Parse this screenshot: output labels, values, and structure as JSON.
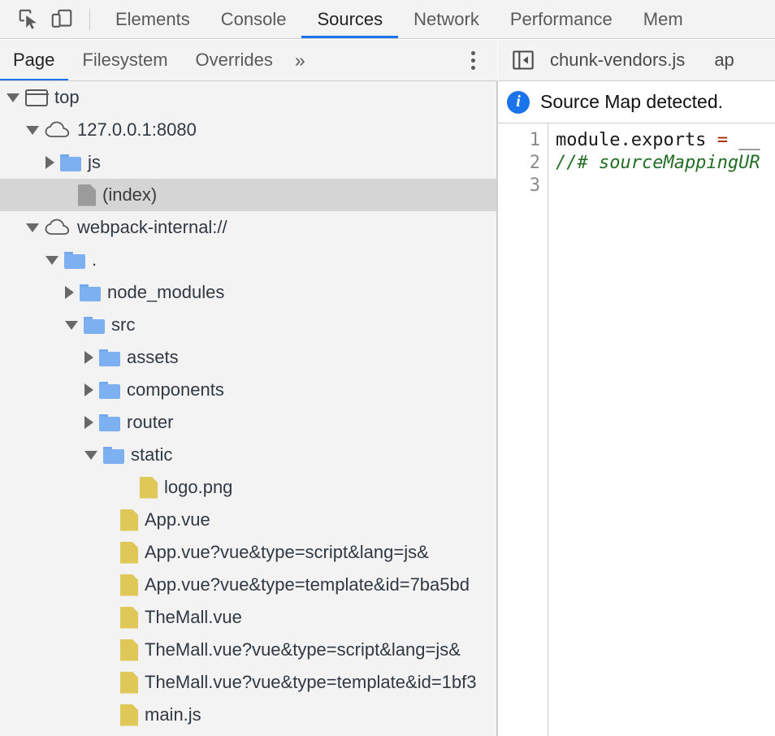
{
  "main_toolbar": {
    "icons": [
      {
        "name": "inspect-element-icon",
        "title": "Inspect element"
      },
      {
        "name": "device-toolbar-icon",
        "title": "Toggle device toolbar"
      }
    ],
    "tabs": [
      {
        "label": "Elements",
        "active": false
      },
      {
        "label": "Console",
        "active": false
      },
      {
        "label": "Sources",
        "active": true
      },
      {
        "label": "Network",
        "active": false
      },
      {
        "label": "Performance",
        "active": false
      },
      {
        "label": "Mem",
        "active": false
      }
    ]
  },
  "navigator": {
    "tabs": [
      {
        "label": "Page",
        "active": true
      },
      {
        "label": "Filesystem",
        "active": false
      },
      {
        "label": "Overrides",
        "active": false
      }
    ],
    "more_tabs_label": "»",
    "menu_icon": "more-options-icon",
    "tree": [
      {
        "label": "top",
        "icon": "frame-icon",
        "twisty": "open",
        "indent": 0,
        "selected": false
      },
      {
        "label": "127.0.0.1:8080",
        "icon": "cloud-icon",
        "twisty": "open",
        "indent": 1,
        "selected": false
      },
      {
        "label": "js",
        "icon": "folder-icon",
        "twisty": "closed",
        "indent": 2,
        "selected": false
      },
      {
        "label": "(index)",
        "icon": "document-icon",
        "twisty": "none",
        "indent": 2,
        "selected": true
      },
      {
        "label": "webpack-internal://",
        "icon": "cloud-icon",
        "twisty": "open",
        "indent": 1,
        "selected": false
      },
      {
        "label": ".",
        "icon": "folder-icon",
        "twisty": "open",
        "indent": 2,
        "selected": false
      },
      {
        "label": "node_modules",
        "icon": "folder-icon",
        "twisty": "closed",
        "indent": 3,
        "selected": false
      },
      {
        "label": "src",
        "icon": "folder-icon",
        "twisty": "open",
        "indent": 3,
        "selected": false
      },
      {
        "label": "assets",
        "icon": "folder-icon",
        "twisty": "closed",
        "indent": 4,
        "selected": false
      },
      {
        "label": "components",
        "icon": "folder-icon",
        "twisty": "closed",
        "indent": 4,
        "selected": false
      },
      {
        "label": "router",
        "icon": "folder-icon",
        "twisty": "closed",
        "indent": 4,
        "selected": false
      },
      {
        "label": "static",
        "icon": "folder-icon",
        "twisty": "open",
        "indent": 4,
        "selected": false
      },
      {
        "label": "logo.png",
        "icon": "file-icon",
        "twisty": "none",
        "indent": 5,
        "selected": false
      },
      {
        "label": "App.vue",
        "icon": "file-icon",
        "twisty": "none",
        "indent": 4,
        "selected": false
      },
      {
        "label": "App.vue?vue&type=script&lang=js&",
        "icon": "file-icon",
        "twisty": "none",
        "indent": 4,
        "selected": false
      },
      {
        "label": "App.vue?vue&type=template&id=7ba5bd",
        "icon": "file-icon",
        "twisty": "none",
        "indent": 4,
        "selected": false
      },
      {
        "label": "TheMall.vue",
        "icon": "file-icon",
        "twisty": "none",
        "indent": 4,
        "selected": false
      },
      {
        "label": "TheMall.vue?vue&type=script&lang=js&",
        "icon": "file-icon",
        "twisty": "none",
        "indent": 4,
        "selected": false
      },
      {
        "label": "TheMall.vue?vue&type=template&id=1bf3",
        "icon": "file-icon",
        "twisty": "none",
        "indent": 4,
        "selected": false
      },
      {
        "label": "main.js",
        "icon": "file-icon",
        "twisty": "none",
        "indent": 4,
        "selected": false
      }
    ]
  },
  "editor": {
    "collapse_icon": "collapse-sidebar-icon",
    "tabs": [
      {
        "label": "chunk-vendors.js",
        "active": false
      },
      {
        "label": "ap",
        "active": false
      }
    ],
    "infobar": {
      "icon": "info-icon",
      "text": "Source Map detected."
    },
    "line_numbers": [
      "1",
      "2",
      "3"
    ],
    "code": {
      "line1_a": "module.exports = ",
      "line1_op": "=",
      "line1_pre": "module.exports ",
      "line1_post": " __",
      "line2": "//# sourceMappingUR",
      "line3": ""
    }
  },
  "colors": {
    "accent": "#1a73e8",
    "toolbar_bg": "#f3f3f3",
    "selected_row": "#d5d5d5",
    "folder": "#7cb0f0",
    "file": "#dfc758",
    "comment": "#236e25",
    "operator": "#a52a00"
  }
}
